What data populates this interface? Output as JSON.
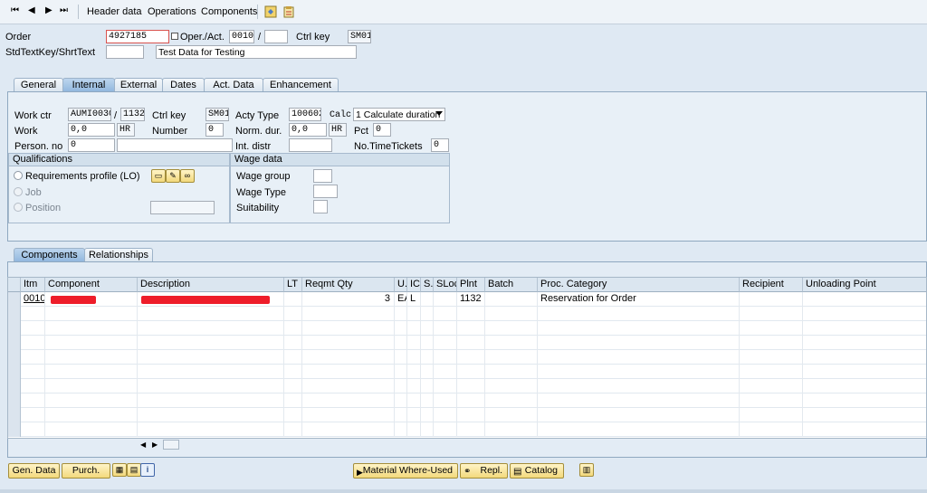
{
  "toolbar": {
    "nav": [
      "⏮",
      "◀",
      "▶",
      "⏭"
    ],
    "items": [
      "Header data",
      "Operations",
      "Components"
    ],
    "icons": [
      "settings-icon",
      "clipboard-icon"
    ]
  },
  "header": {
    "order_label": "Order",
    "order_value": "4927185",
    "operact_label": "Oper./Act.",
    "operact_value": "0010",
    "operact_sep": "/",
    "ctrlkey_label": "Ctrl key",
    "ctrlkey_value": "SM01",
    "stdtext_label": "StdTextKey/ShrtText",
    "stdtext_value": "",
    "shorttext_value": "Test Data for Testing"
  },
  "tabs": [
    "General",
    "Internal",
    "External",
    "Dates",
    "Act. Data",
    "Enhancement"
  ],
  "internal": {
    "workctr_label": "Work ctr",
    "workctr_value": "AUMI0030",
    "workctr_sep": "/",
    "plant_value": "1132",
    "ctrlkey_label": "Ctrl key",
    "ctrlkey_value": "SM01",
    "acttype_label": "Acty Type",
    "acttype_value": "100602",
    "calc_label": "Calc",
    "calc_value": "1 Calculate duration",
    "work_label": "Work",
    "work_value": "0,0",
    "work_unit": "HR",
    "number_label": "Number",
    "number_value": "0",
    "normdur_label": "Norm. dur.",
    "normdur_value": "0,0",
    "normdur_unit": "HR",
    "pct_label": "Pct",
    "pct_value": "0",
    "personno_label": "Person. no",
    "personno_value": "0",
    "intdistr_label": "Int. distr",
    "notimetickets_label": "No.TimeTickets",
    "notimetickets_value": "0"
  },
  "qualifications": {
    "title": "Qualifications",
    "req_profile": "Requirements profile (LO)",
    "job": "Job",
    "position": "Position"
  },
  "wagedata": {
    "title": "Wage data",
    "wage_group": "Wage group",
    "wage_type": "Wage Type",
    "suitability": "Suitability"
  },
  "bottom_tabs": [
    "Components",
    "Relationships"
  ],
  "grid": {
    "columns": [
      "Itm",
      "Component",
      "Description",
      "LT",
      "Reqmt Qty",
      "U..",
      "IC",
      "S..",
      "SLoc",
      "Plnt",
      "Batch",
      "Proc. Category",
      "Recipient",
      "Unloading Point"
    ],
    "rows": [
      {
        "itm": "0010",
        "reqmt": "3",
        "unit": "EA",
        "ic": "L",
        "plnt": "1132",
        "proc": "Reservation for Order"
      }
    ]
  },
  "buttons": {
    "gen_data": "Gen. Data",
    "purch": "Purch.",
    "material_where_used": "Material Where-Used",
    "repl": "Repl.",
    "catalog": "Catalog"
  },
  "colors": {
    "background": "#dfe9f3",
    "active_tab": "#8fb6dd",
    "button": "#f3d97c",
    "redaction": "#ee1d2a"
  }
}
